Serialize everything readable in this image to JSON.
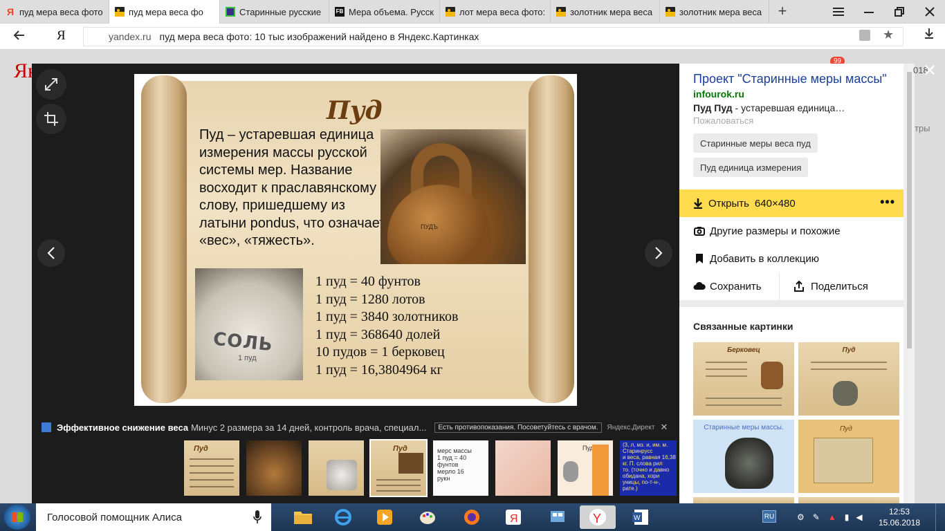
{
  "tabs": [
    {
      "label": "пуд мера веса фото",
      "icon": "yandex-favicon"
    },
    {
      "label": "пуд мера веса фо",
      "icon": "image-favicon"
    },
    {
      "label": "Старинные русские",
      "icon": "site-favicon"
    },
    {
      "label": "Мера объема. Русск",
      "icon": "fb-favicon"
    },
    {
      "label": "лот мера веса фото:",
      "icon": "image-favicon"
    },
    {
      "label": "золотник мера веса",
      "icon": "image-favicon"
    },
    {
      "label": "золотник мера веса",
      "icon": "image-favicon"
    }
  ],
  "address": {
    "domain": "yandex.ru",
    "title": "пуд мера веса фото: 10 тыс изображений найдено в Яндекс.Картинках",
    "browser_logo": "Я"
  },
  "bg": {
    "logo": "Ян",
    "badge": "99",
    "side_text1": "018",
    "side_text2": "тры"
  },
  "image": {
    "title": "Пуд",
    "description": "Пуд – устаревшая единица измерения массы русской системы мер. Название восходит к праславянскому слову, пришедшему из латыни pondus, что означает «вес», «тяжесть».",
    "kettle_mark": "ПУДЪ",
    "sack_word": "СОЛЬ",
    "sack_sub": "1 пуд",
    "equivalences": [
      "1 пуд = 40 фунтов",
      "1 пуд = 1280 лотов",
      "1 пуд = 3840 золотников",
      "1 пуд = 368640 долей",
      "10 пудов = 1 берковец",
      "1 пуд = 16,3804964 кг"
    ]
  },
  "ad": {
    "title": "Эффективное снижение веса",
    "text": "Минус 2 размера за 14 дней, контроль врача, специал...",
    "warning": "Есть противопоказания. Посоветуйтесь с врачом.",
    "source": "Яндекс.Директ"
  },
  "thumbs": [
    {
      "type": "scroll",
      "label": "Пуд"
    },
    {
      "type": "kettle",
      "label": ""
    },
    {
      "type": "sack",
      "label": ""
    },
    {
      "type": "scroll-selected",
      "label": "Пуд"
    },
    {
      "type": "white",
      "label": "мерс массы\n1 пуд = 40 фунтов\nмерло 16\nрукн"
    },
    {
      "type": "pink",
      "label": ""
    },
    {
      "type": "peach",
      "label": "Пуд"
    },
    {
      "type": "blue",
      "label": "(3, л, мз. и, им. м. Старинрусс\nи веса, равная 16,38 кг. П. слова рил\nто. (точно и давно обидана, хори\nуницы, по-т-н-, рате.)"
    }
  ],
  "panel": {
    "title": "Проект \"Старинные меры массы\"",
    "domain": "infourok.ru",
    "snippet_bold": "Пуд Пуд",
    "snippet_rest": " - устаревшая единица…",
    "report": "Пожаловаться",
    "tags": [
      "Старинные меры веса пуд",
      "Пуд единица измерения"
    ],
    "open_label": "Открыть",
    "open_size": "640×480",
    "more": "•••",
    "actions": [
      {
        "label": "Другие размеры и похожие",
        "icon": "camera-search-icon"
      },
      {
        "label": "Добавить в коллекцию",
        "icon": "bookmark-icon"
      }
    ],
    "save": "Сохранить",
    "share": "Поделиться",
    "related_title": "Связанные картинки",
    "related": [
      {
        "title": "Берковец"
      },
      {
        "title": "Пуд"
      },
      {
        "title": "Старинные меры массы."
      },
      {
        "title": "Пуд"
      }
    ]
  },
  "taskbar": {
    "assistant": "Голосовой помощник Алиса",
    "lang": "RU",
    "time": "12:53",
    "date": "15.06.2018"
  },
  "colors": {
    "accent_yellow": "#ffdb4d",
    "link_blue": "#1a3e9c",
    "domain_green": "#007700",
    "overlay_dark": "#1c1c1c"
  }
}
